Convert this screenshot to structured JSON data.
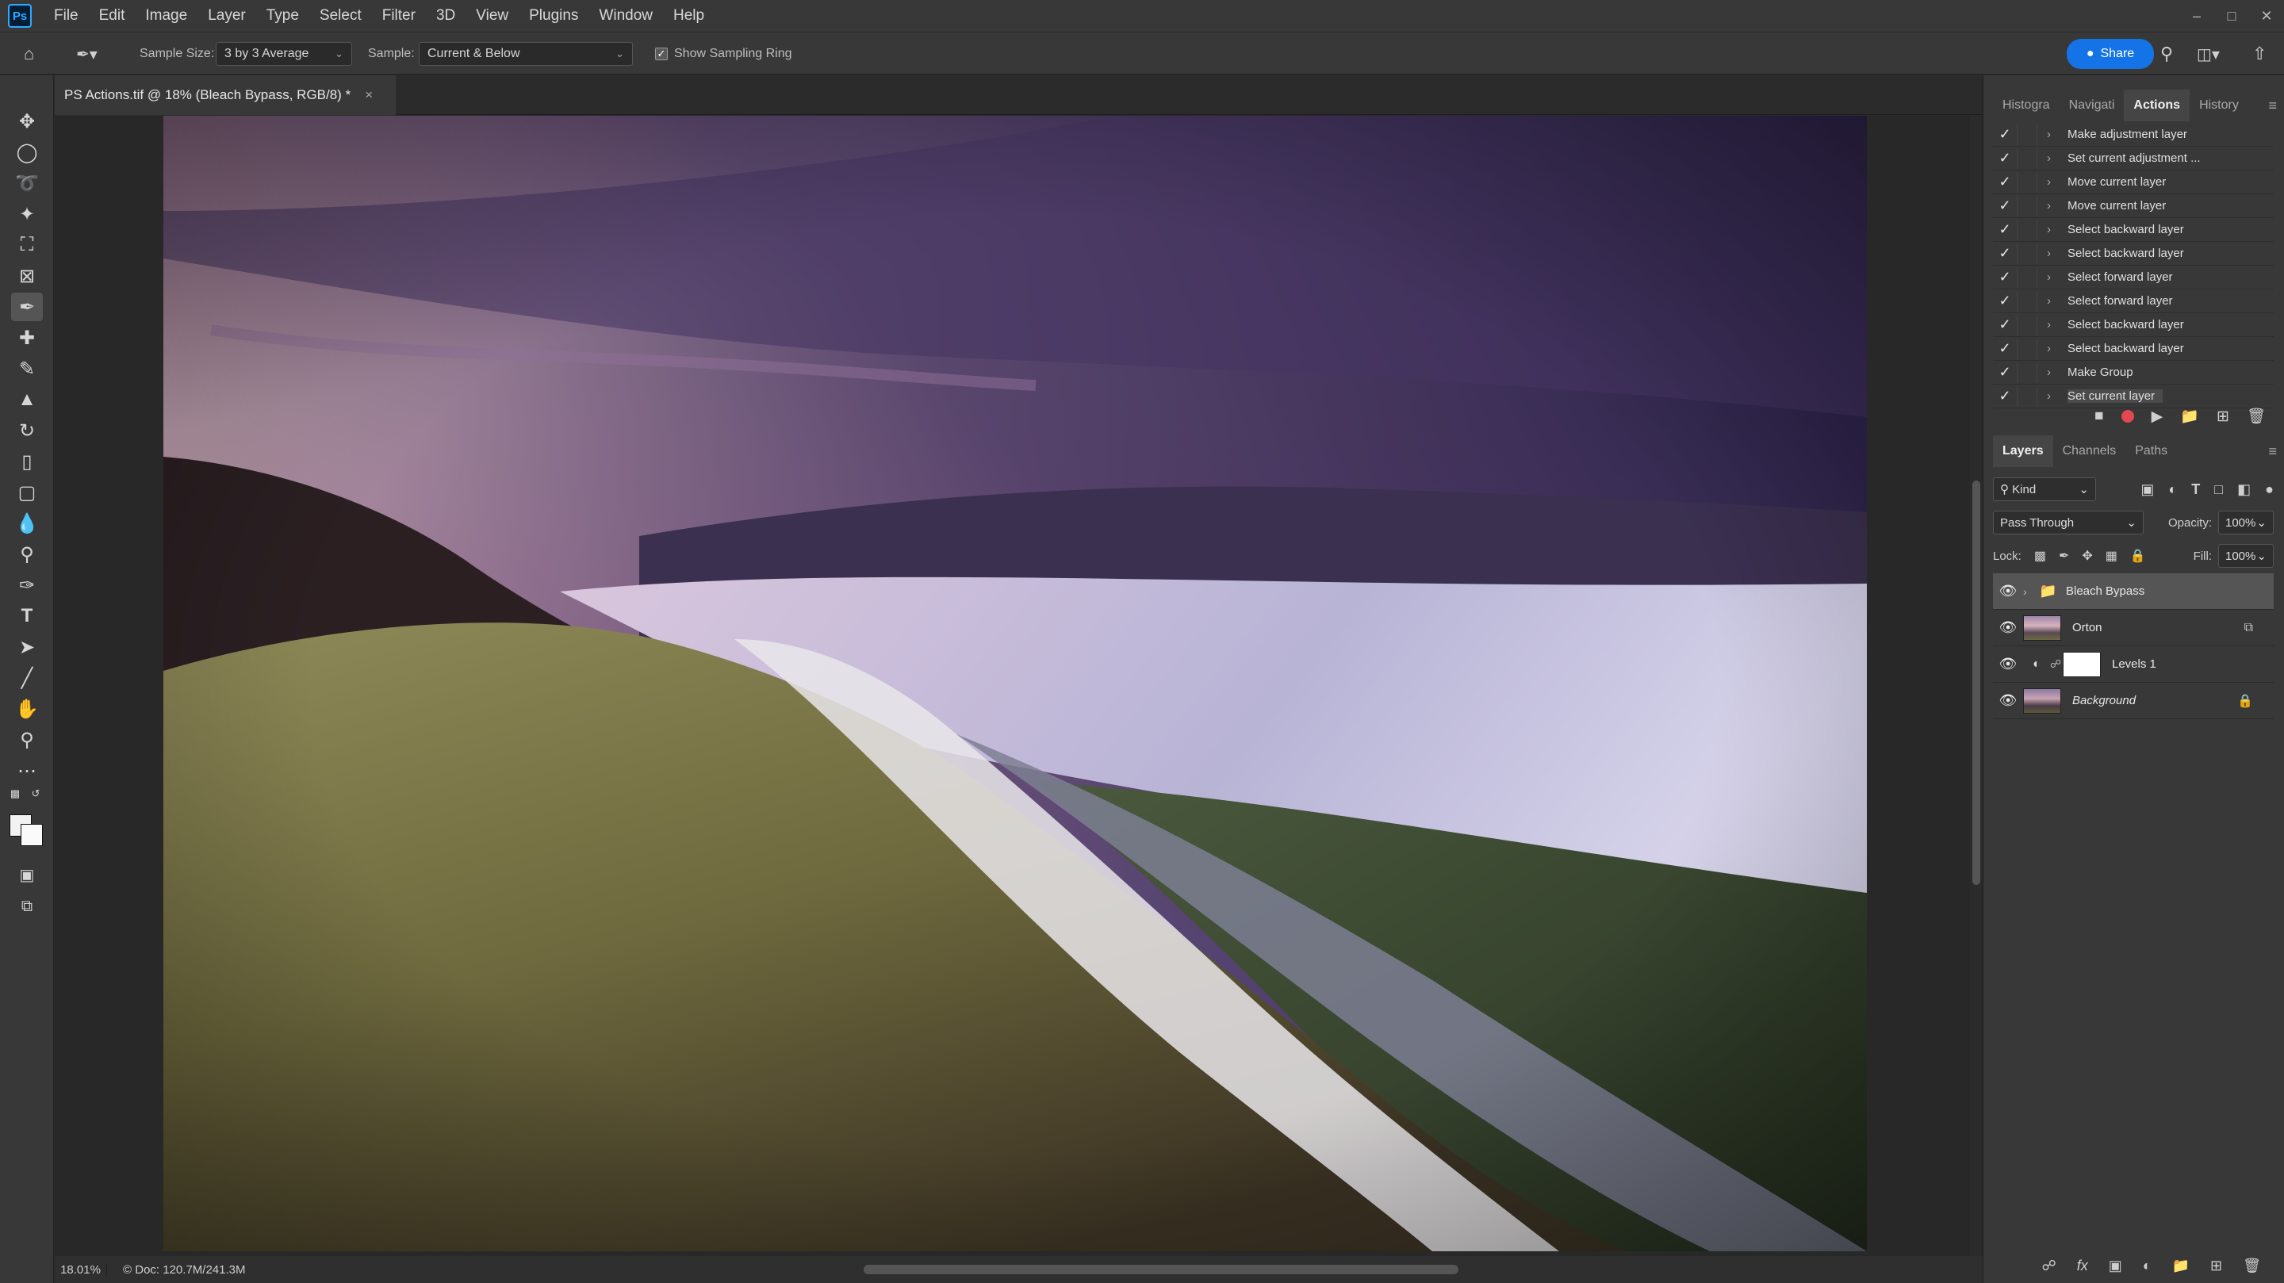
{
  "app": {
    "logo_text": "Ps",
    "menu": [
      "File",
      "Edit",
      "Image",
      "Layer",
      "Type",
      "Select",
      "Filter",
      "3D",
      "View",
      "Plugins",
      "Window",
      "Help"
    ]
  },
  "options_bar": {
    "sample_size_label": "Sample Size:",
    "sample_size_value": "3 by 3 Average",
    "sample_label": "Sample:",
    "sample_value": "Current & Below",
    "show_ring_label": "Show Sampling Ring",
    "show_ring_checked": true,
    "share_label": "Share"
  },
  "document": {
    "tab_title": "PS Actions.tif @ 18% (Bleach Bypass, RGB/8) *",
    "zoom": "18.01%",
    "doc_size": "Doc: 120.7M/241.3M"
  },
  "top_panel": {
    "tabs": [
      "Histogra",
      "Navigati",
      "Actions",
      "History"
    ],
    "active_tab": "Actions",
    "actions": [
      "Make adjustment layer",
      "Set current adjustment ...",
      "Move current layer",
      "Move current layer",
      "Select backward layer",
      "Select backward layer",
      "Select forward layer",
      "Select forward layer",
      "Select backward layer",
      "Select backward layer",
      "Make Group",
      "Set current layer"
    ]
  },
  "layers_panel": {
    "tabs": [
      "Layers",
      "Channels",
      "Paths"
    ],
    "active_tab": "Layers",
    "filter_kind": "Kind",
    "blend_mode": "Pass Through",
    "opacity_label": "Opacity:",
    "opacity_value": "100%",
    "lock_label": "Lock:",
    "fill_label": "Fill:",
    "fill_value": "100%",
    "layers": [
      {
        "name": "Bleach Bypass",
        "type": "group"
      },
      {
        "name": "Orton",
        "type": "smart-object"
      },
      {
        "name": "Levels 1",
        "type": "adjustment"
      },
      {
        "name": "Background",
        "type": "background"
      }
    ]
  },
  "colors": {
    "accent": "#1473e6",
    "record": "#e34850",
    "panel_bg": "#383838",
    "canvas_bg": "#282828"
  }
}
